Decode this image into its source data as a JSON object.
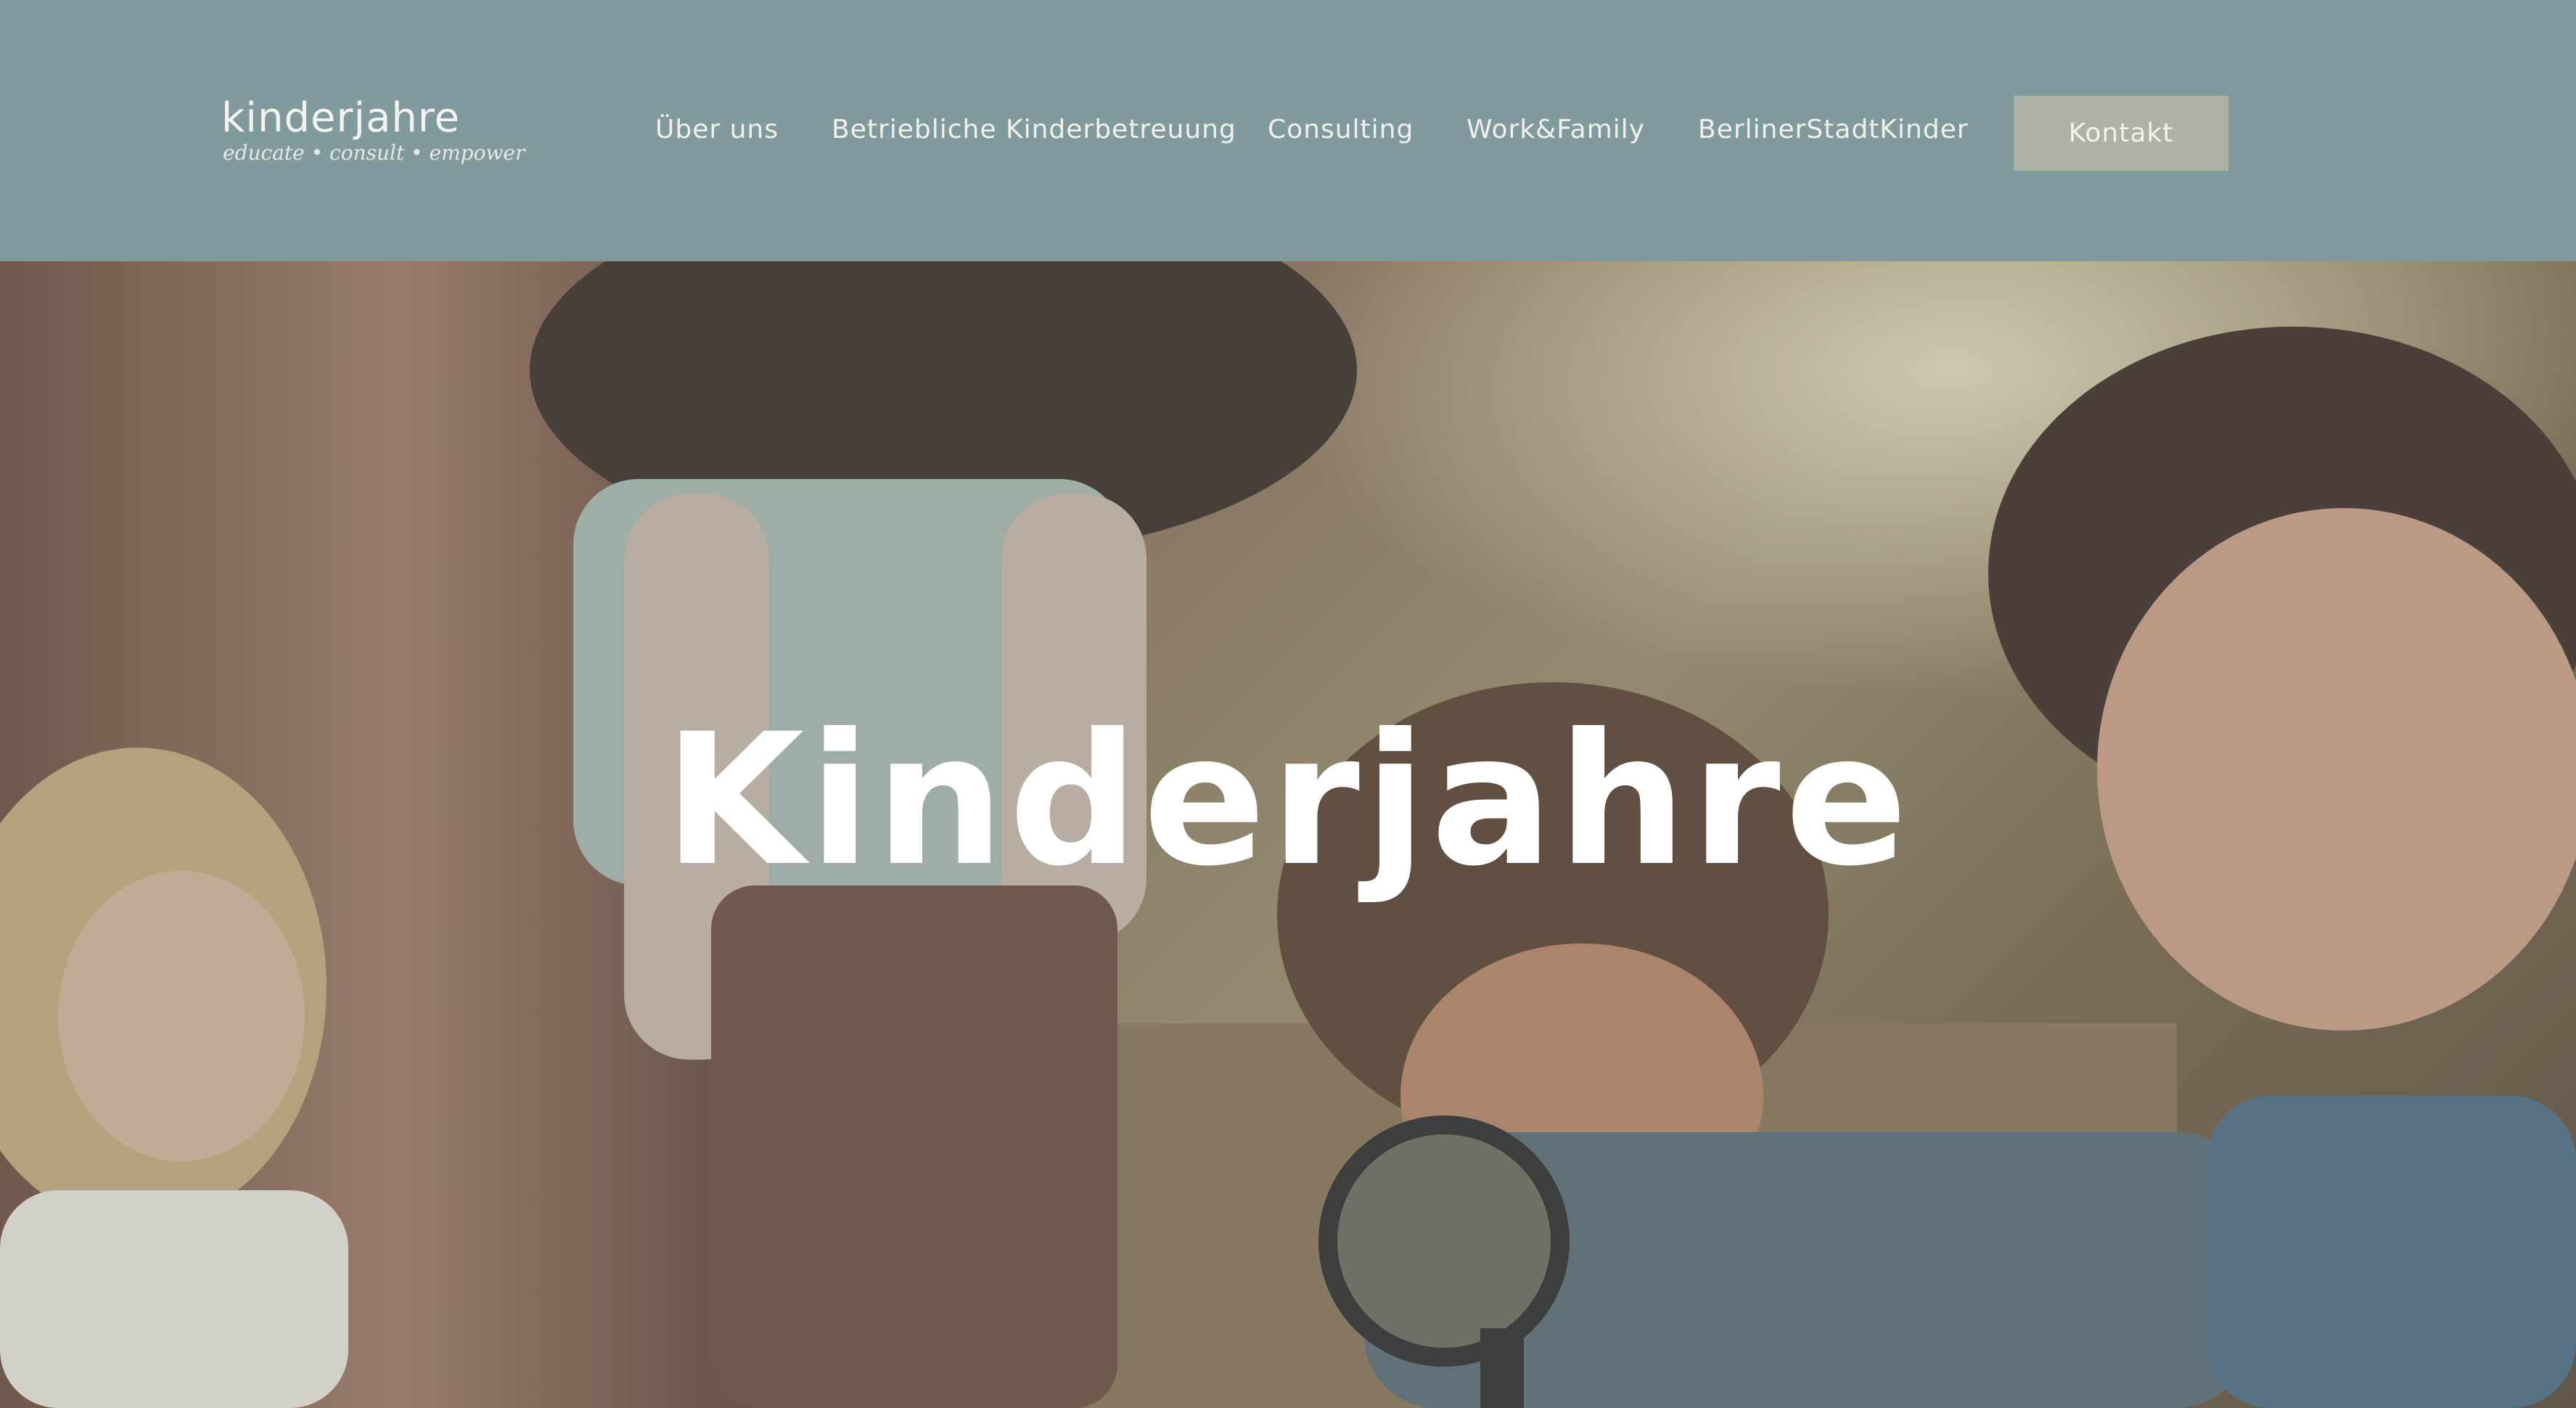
{
  "brand": {
    "name": "kinderjahre",
    "tagline": "educate • consult • empower"
  },
  "nav": {
    "items": [
      {
        "label": "Über uns"
      },
      {
        "label": "Betriebliche Kinderbetreuung"
      },
      {
        "label": "Consulting"
      },
      {
        "label": "Work&Family"
      },
      {
        "label": "BerlinerStadtKinder"
      }
    ],
    "contact_label": "Kontakt"
  },
  "hero": {
    "title": "Kinderjahre",
    "image": "photo of four children exploring in a forest with a magnifying glass"
  },
  "colors": {
    "header_bg": "#819a9d",
    "button_bg": "#aeb2a6",
    "text_light": "#f1f1ec"
  }
}
